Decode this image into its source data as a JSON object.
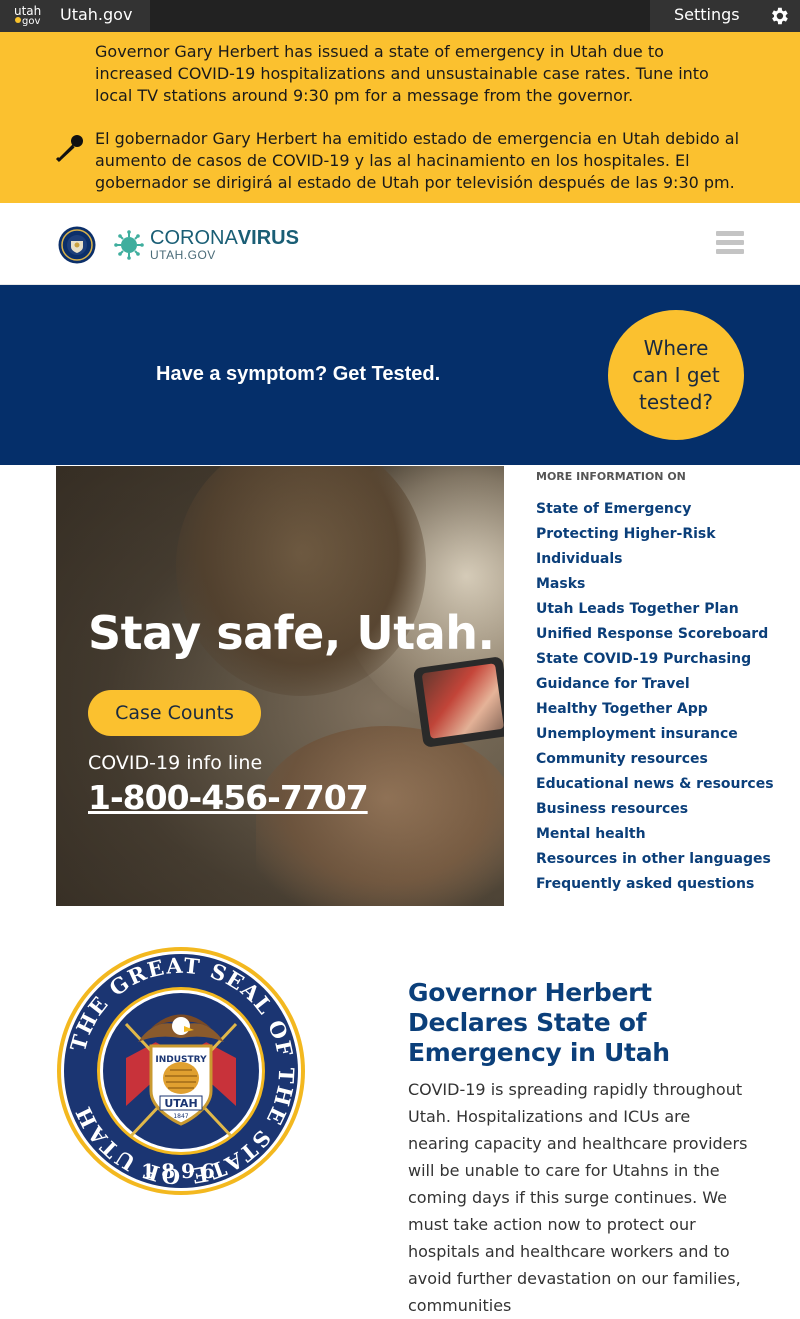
{
  "topbar": {
    "logo_top": "utah",
    "logo_bottom": "gov",
    "site_name": "Utah.gov",
    "settings_label": "Settings"
  },
  "alert": {
    "english": "Governor Gary Herbert has issued a state of emergency in Utah due to increased COVID-19 hospitalizations and unsustainable case rates. Tune into local TV stations around 9:30 pm for a message from the governor.",
    "spanish": "El gobernador Gary Herbert ha emitido estado de emergencia en Utah debido al aumento de casos de COVID-19 y las al hacinamiento en los hospitales. El gobernador se dirigirá al estado de Utah por televisión después de las 9:30 pm."
  },
  "header": {
    "brand_light": "CORONA",
    "brand_bold": "VIRUS",
    "brand_sub": "UTAH.GOV"
  },
  "band": {
    "text": "Have a symptom? Get Tested.",
    "cta": "Where can I get tested?"
  },
  "hero": {
    "headline": "Stay safe, Utah.",
    "button": "Case Counts",
    "info_line": "COVID-19 info line",
    "phone": "1-800-456-7707"
  },
  "sidebar": {
    "heading": "MORE INFORMATION ON",
    "links": [
      "State of Emergency",
      "Protecting Higher-Risk",
      "Individuals",
      "Masks",
      "Utah Leads Together Plan",
      "Unified Response Scoreboard",
      "State COVID-19 Purchasing",
      "Guidance for Travel",
      "Healthy Together App",
      "Unemployment insurance",
      "Community resources",
      "Educational news & resources",
      "Business resources",
      "Mental health",
      "Resources in other languages",
      "Frequently asked questions"
    ]
  },
  "seal": {
    "ring_text": "THE GREAT SEAL OF THE STATE OF UTAH",
    "year": "1896",
    "shield_top": "INDUSTRY",
    "shield_bottom": "UTAH",
    "shield_year": "1847"
  },
  "article": {
    "title": "Governor Herbert Declares State of Emergency in Utah",
    "body": "COVID-19 is spreading rapidly throughout Utah. Hospitalizations and ICUs are nearing capacity and healthcare providers will be unable to care for Utahns in the coming days if this surge continues. We must take action now to protect our hospitals and healthcare workers and to avoid further devastation on our families, communities"
  },
  "colors": {
    "alert_bg": "#fbc12f",
    "band_bg": "#052f6a",
    "link": "#0b3f7a",
    "topbar_bg": "#222222"
  }
}
